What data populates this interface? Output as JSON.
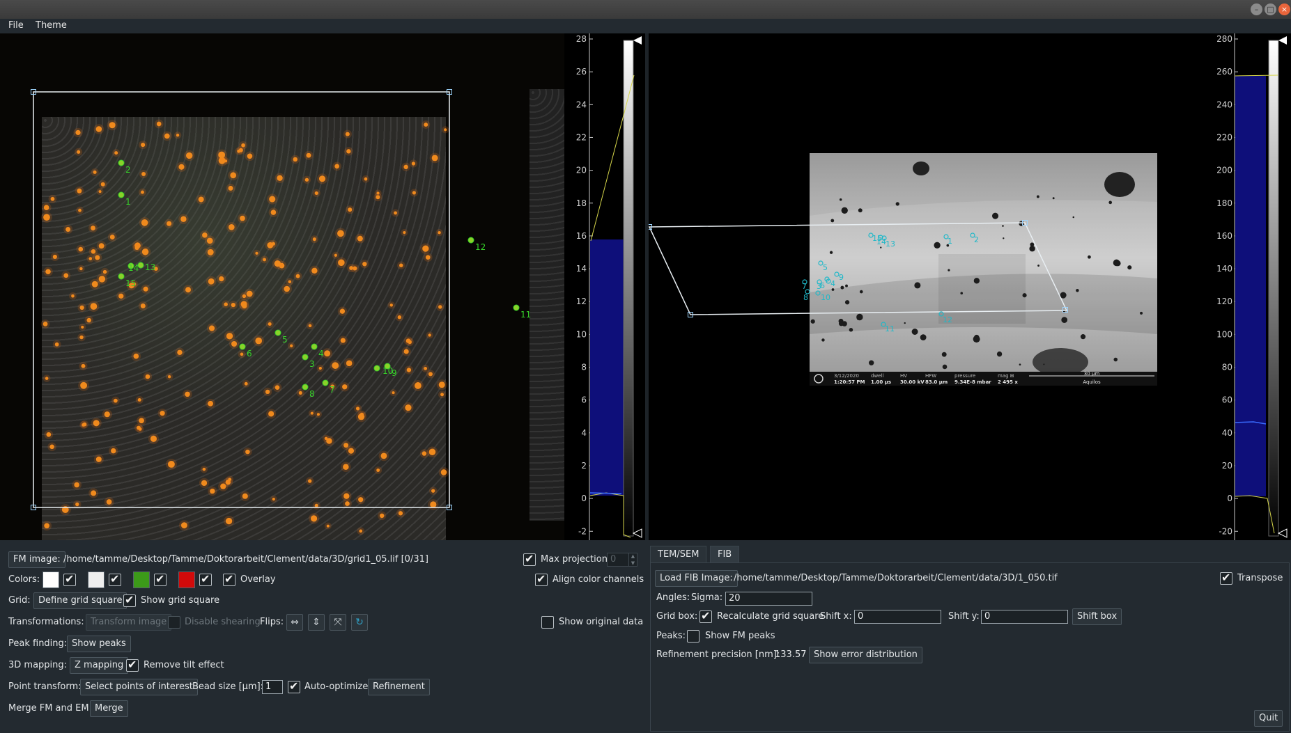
{
  "window": {
    "minimize_glyph": "–",
    "maximize_glyph": "□",
    "close_glyph": "×"
  },
  "menu": {
    "file": "File",
    "theme": "Theme"
  },
  "fm_view": {
    "peak_labels": [
      "1",
      "2",
      "3",
      "4",
      "5",
      "6",
      "7",
      "8",
      "9",
      "10",
      "11",
      "12",
      "13",
      "14",
      "15"
    ],
    "peak_color": "#37d42a",
    "histogram_ticks": [
      "28",
      "26",
      "24",
      "22",
      "20",
      "18",
      "16",
      "14",
      "12",
      "10",
      "8",
      "6",
      "4",
      "2",
      "0",
      "-2"
    ]
  },
  "em_view": {
    "peak_labels": [
      "1",
      "2",
      "3",
      "4",
      "5",
      "6",
      "7",
      "8",
      "9",
      "10",
      "11",
      "12",
      "13",
      "14",
      "15"
    ],
    "peak_color": "#1fb8c8",
    "histogram_ticks": [
      "280",
      "260",
      "240",
      "220",
      "200",
      "180",
      "160",
      "140",
      "120",
      "100",
      "80",
      "60",
      "40",
      "20",
      "0",
      "-20"
    ],
    "sem_info": {
      "headers": [
        "3/12/2020",
        "dwell",
        "HV",
        "HFW",
        "pressure",
        "mag ⊞"
      ],
      "values": [
        "1:20:57 PM",
        "1.00 µs",
        "30.00 kV",
        "83.0 µm",
        "9.34E-8 mbar",
        "2 495 x"
      ],
      "scalebar": "30 µm",
      "instrument": "Aquilos"
    }
  },
  "fm_controls": {
    "fm_image_button": "FM image:",
    "fm_path": "/home/tamme/Desktop/Tamme/Doktorarbeit/Clement/data/3D/grid1_05.lif [0/31]",
    "max_projection_label": "Max projection",
    "max_projection_value": "0",
    "colors_label": "Colors:",
    "color_swatches": [
      "#ffffff",
      "#eeeeee",
      "#3c9a19",
      "#d10a0a"
    ],
    "overlay_label": "Overlay",
    "align_channels_label": "Align color channels",
    "grid_label": "Grid:",
    "define_grid_button": "Define grid square",
    "show_grid_label": "Show grid square",
    "transformations_label": "Transformations:",
    "transform_image_button": "Transform image",
    "disable_shearing_label": "Disable shearing",
    "flips_label": "Flips:",
    "show_original_label": "Show original data",
    "peak_finding_label": "Peak finding:",
    "show_peaks_button": "Show peaks",
    "mapping_label": "3D mapping:",
    "z_mapping_button": "Z mapping",
    "remove_tilt_label": "Remove tilt effect",
    "point_transform_label": "Point transform:",
    "select_points_button": "Select points of interest",
    "bead_size_label": "Bead size [µm]:",
    "bead_size_value": "1",
    "auto_optimize_label": "Auto-optimize",
    "refinement_button": "Refinement",
    "merge_label": "Merge FM and EM:",
    "merge_button": "Merge"
  },
  "em_controls": {
    "tabs": [
      "TEM/SEM",
      "FIB"
    ],
    "active_tab": "FIB",
    "load_fib_button": "Load FIB Image:",
    "fib_path": "/home/tamme/Desktop/Tamme/Doktorarbeit/Clement/data/3D/1_050.tif",
    "transpose_label": "Transpose",
    "angles_label": "Angles:",
    "sigma_label": "Sigma:",
    "sigma_value": "20",
    "grid_box_label": "Grid box:",
    "recalc_label": "Recalculate grid square",
    "shift_x_label": "Shift x:",
    "shift_x_value": "0",
    "shift_y_label": "Shift y:",
    "shift_y_value": "0",
    "shift_box_button": "Shift box",
    "peaks_label": "Peaks:",
    "show_fm_peaks_label": "Show FM peaks",
    "refinement_precision_label": "Refinement precision [nm]:",
    "refinement_precision_value": "133.57",
    "show_error_button": "Show error distribution",
    "quit_button": "Quit"
  }
}
